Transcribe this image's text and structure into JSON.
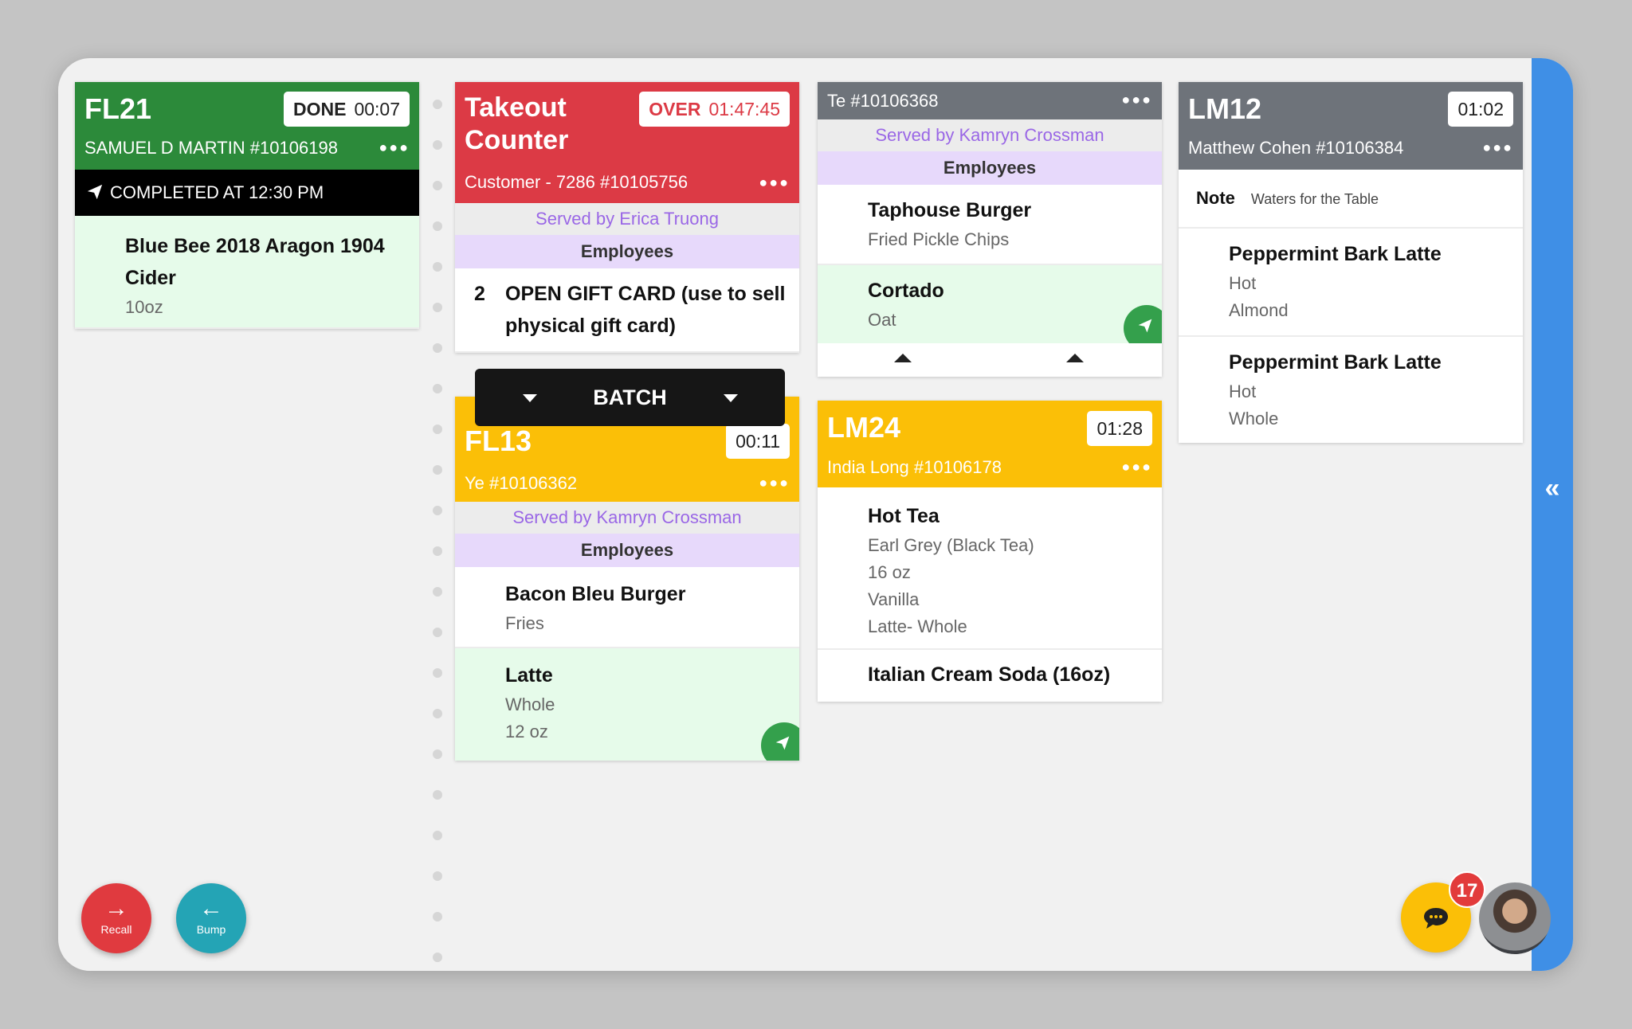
{
  "orders": {
    "fl21": {
      "code": "FL21",
      "status": "DONE",
      "timer": "00:07",
      "customer": "SAMUEL D MARTIN #10106198",
      "completed": "COMPLETED AT 12:30 PM",
      "items": [
        {
          "name": "Blue Bee 2018 Aragon 1904 Cider",
          "mods": [
            "10oz"
          ]
        }
      ]
    },
    "takeout": {
      "code_line1": "Takeout",
      "code_line2": "Counter",
      "status": "OVER",
      "timer": "01:47:45",
      "customer": "Customer - 7286 #10105756",
      "served_by": "Served by Erica Truong",
      "group": "Employees",
      "items": [
        {
          "qty": "2",
          "name_line1": "OPEN GIFT CARD (use to sell",
          "name_line2": "physical gift card)"
        }
      ]
    },
    "batch_label": "BATCH",
    "fl13": {
      "code": "FL13",
      "timer": "00:11",
      "customer": "Ye #10106362",
      "served_by": "Served by Kamryn Crossman",
      "group": "Employees",
      "items": [
        {
          "name": "Bacon Bleu Burger",
          "mods": [
            "Fries"
          ]
        },
        {
          "name": "Latte",
          "mods": [
            "Whole",
            "12 oz"
          ]
        }
      ]
    },
    "te": {
      "customer": "Te #10106368",
      "served_by": "Served by Kamryn Crossman",
      "group": "Employees",
      "items": [
        {
          "name": "Taphouse Burger",
          "mods": [
            "Fried Pickle Chips"
          ]
        },
        {
          "name": "Cortado",
          "mods": [
            "Oat"
          ]
        }
      ]
    },
    "lm24": {
      "code": "LM24",
      "timer": "01:28",
      "customer": "India Long #10106178",
      "items": [
        {
          "name": "Hot Tea",
          "mods": [
            "Earl Grey (Black Tea)",
            "16 oz",
            "Vanilla",
            "Latte- Whole"
          ]
        },
        {
          "name": "Italian Cream Soda (16oz)",
          "mods": []
        }
      ]
    },
    "lm12": {
      "code": "LM12",
      "timer": "01:02",
      "customer": "Matthew Cohen #10106384",
      "note_label": "Note",
      "note_text": "Waters for the Table",
      "items": [
        {
          "name": "Peppermint Bark Latte",
          "mods": [
            "Hot",
            "Almond"
          ]
        },
        {
          "name": "Peppermint Bark Latte",
          "mods": [
            "Hot",
            "Whole"
          ]
        }
      ]
    }
  },
  "actions": {
    "recall_label": "Recall",
    "bump_label": "Bump"
  },
  "chat": {
    "unread": "17"
  },
  "icons": {
    "more": "more-dots-icon",
    "sent": "paper-plane-icon",
    "collapse": "double-chevron-left-icon",
    "chat": "chat-bubble-icon",
    "recall": "arrow-right-icon",
    "bump": "arrow-left-icon"
  },
  "colors": {
    "done": "#2c8a3a",
    "over": "#dc3a45",
    "neutral": "#6e737a",
    "warning": "#fbbf07",
    "rail": "#3f8fe6"
  }
}
